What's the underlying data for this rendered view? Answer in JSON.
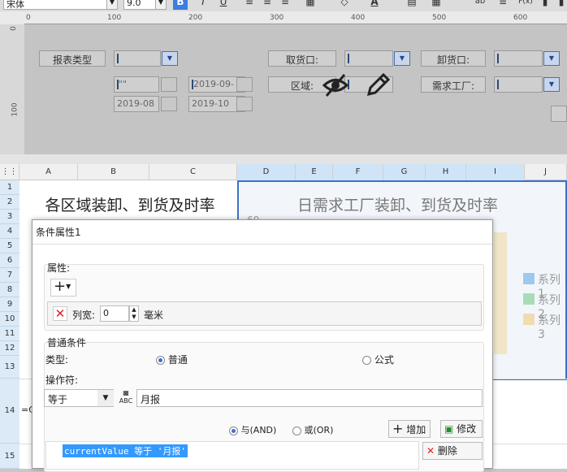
{
  "toolbar": {
    "font_name": "宋体",
    "font_size": "9.0",
    "bold": "B",
    "italic": "I",
    "underline": "U",
    "font_color": "A",
    "strike": "ab",
    "fx": "F(x)"
  },
  "ruler": {
    "h_ticks": [
      "0",
      "100",
      "200",
      "300",
      "400",
      "500",
      "600"
    ],
    "v_ticks": [
      "0",
      "100"
    ]
  },
  "form": {
    "report_type_label": "报表类型",
    "pickup_label": "取货口:",
    "unload_label": "卸货口:",
    "region_label": "区域:",
    "factory_label": "需求工厂:",
    "date_from_1": "\"\"",
    "date_to_1": "2019-09-",
    "date_from_2": "2019-08",
    "date_to_2": "2019-10"
  },
  "sheet": {
    "columns": [
      "A",
      "B",
      "C",
      "D",
      "E",
      "F",
      "G",
      "H",
      "I",
      "J"
    ],
    "rows": [
      "1",
      "2",
      "3",
      "4",
      "5",
      "6",
      "7",
      "8",
      "9",
      "10",
      "11",
      "12",
      "13",
      "14",
      "15"
    ],
    "cell_title": "各区域装卸、到货及时率",
    "chart_title": "日需求工厂装卸、到货及时率",
    "chart_axis_value": "60",
    "legend": [
      "系列1",
      "系列2",
      "系列3"
    ],
    "cell_14": "=C"
  },
  "colors": {
    "legend": [
      "#9ec9ef",
      "#a8dcb6",
      "#f0dcb0"
    ],
    "selection": "#3a73c9"
  },
  "dialog": {
    "title": "条件属性1",
    "attr_label": "属性:",
    "add_label": "+",
    "col_width_label": "列宽:",
    "col_width_value": "0",
    "unit": "毫米",
    "normal_cond_label": "普通条件",
    "type_label": "类型:",
    "type_normal": "普通",
    "type_formula": "公式",
    "operator_label": "操作符:",
    "operator_value": "等于",
    "operand_value": "月报",
    "and_label": "与(AND)",
    "or_label": "或(OR)",
    "add_btn": "增加",
    "modify_btn": "修改",
    "delete_btn": "删除",
    "condition_text": "currentValue 等于 '月报'"
  }
}
